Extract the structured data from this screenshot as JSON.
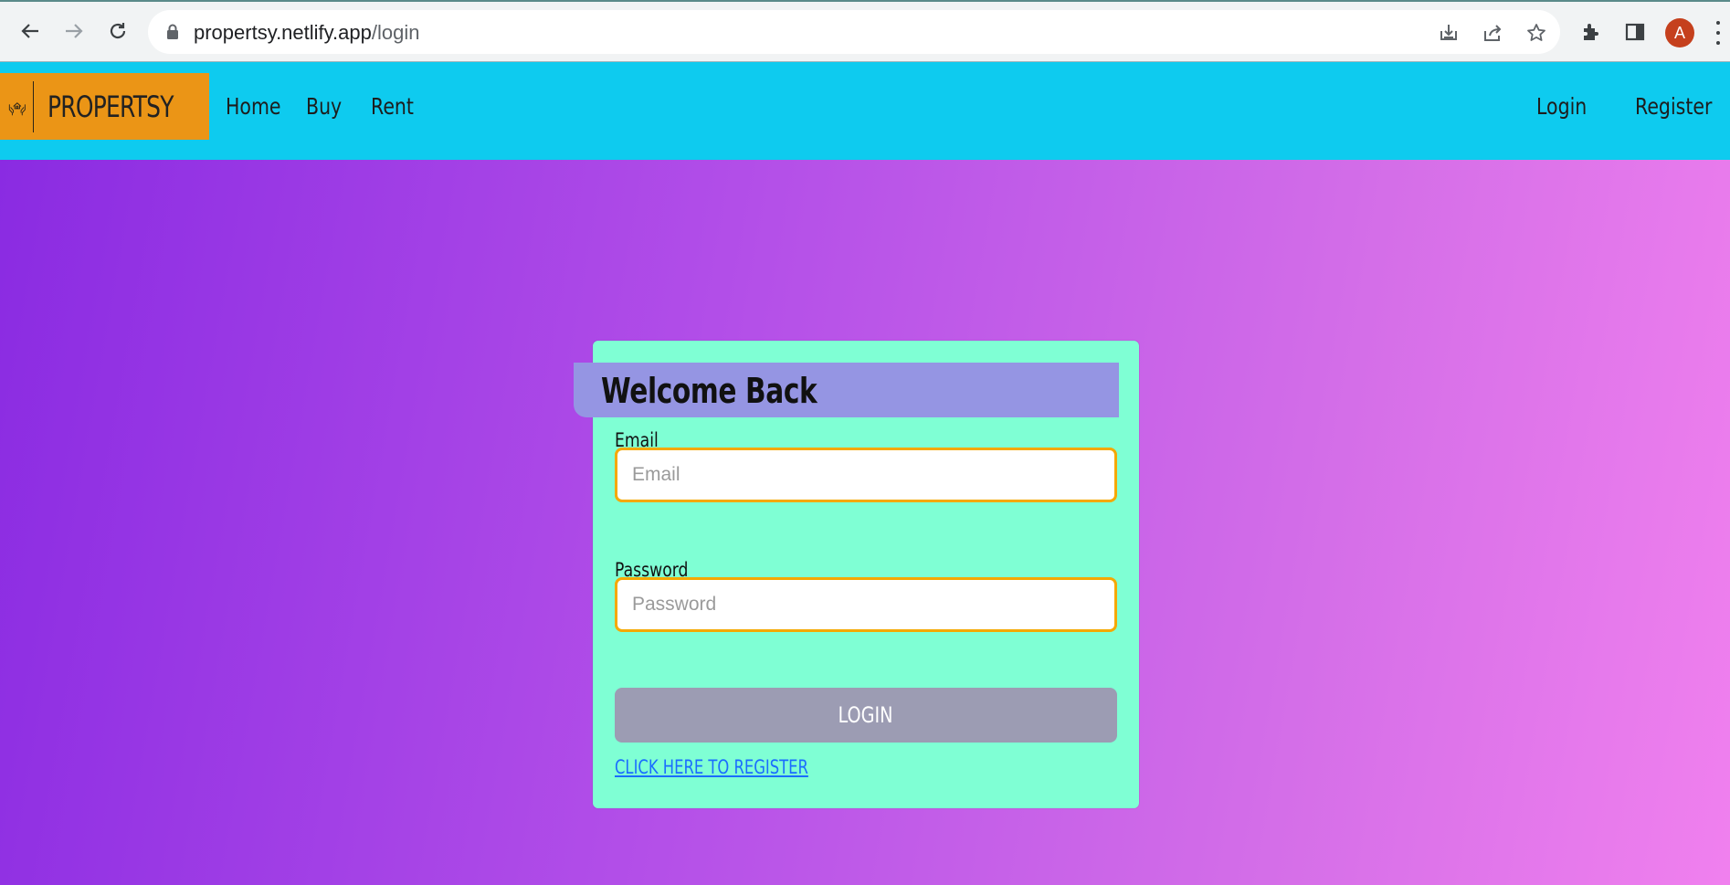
{
  "browser": {
    "url_host": "propertsy.netlify.app",
    "url_path": "/login",
    "profile_initial": "A",
    "icons": [
      "back-arrow-icon",
      "forward-arrow-icon",
      "reload-icon",
      "lock-icon",
      "install-icon",
      "share-icon",
      "bookmark-star-icon",
      "extensions-icon",
      "side-panel-icon",
      "kebab-menu-icon"
    ]
  },
  "navbar": {
    "brand": "PROPERTSY",
    "links": {
      "home": "Home",
      "buy": "Buy",
      "rent": "Rent"
    },
    "right": {
      "login": "Login",
      "register": "Register"
    },
    "colors": {
      "bar": "#0ecbef",
      "brand_bg": "#eb9516"
    }
  },
  "login_card": {
    "title": "Welcome Back",
    "email_label": "Email",
    "email_placeholder": "Email",
    "password_label": "Password",
    "password_placeholder": "Password",
    "submit_label": "LOGIN",
    "register_link": "CLICK HERE TO REGISTER",
    "colors": {
      "card": "#7fffd4",
      "title_bg": "#9595e3",
      "input_border": "#f5a800",
      "button": "#9c9cb3"
    }
  }
}
